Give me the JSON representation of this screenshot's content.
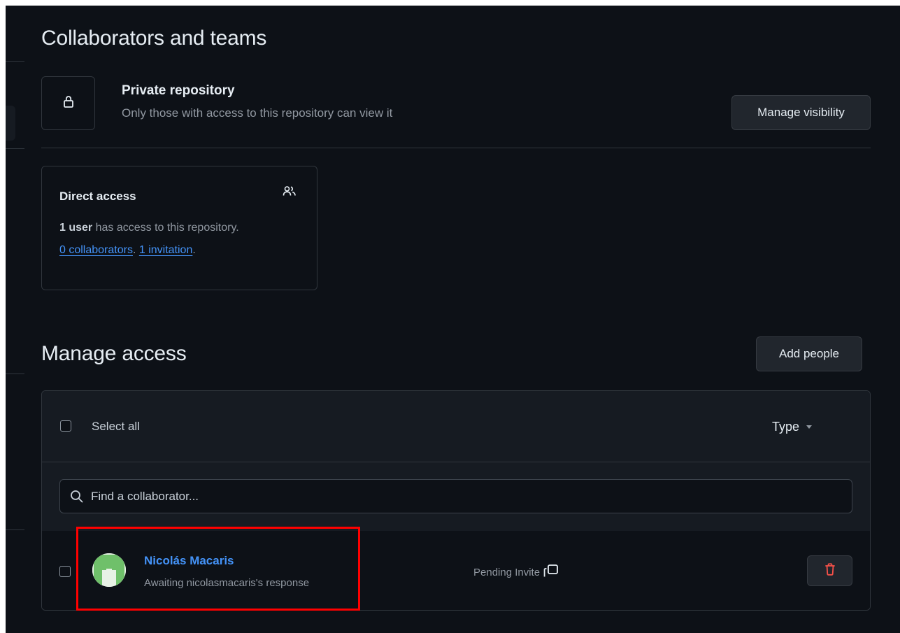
{
  "collaborators": {
    "title": "Collaborators and teams",
    "visibility": {
      "icon": "lock-icon",
      "title": "Private repository",
      "description": "Only those with access to this repository can view it",
      "button_label": "Manage visibility"
    },
    "direct_access": {
      "title": "Direct access",
      "icon": "people-icon",
      "user_count": "1 user",
      "access_text": " has access to this repository.",
      "collaborators_link": "0 collaborators",
      "separator": ". ",
      "invitations_link": "1 invitation",
      "end": "."
    }
  },
  "manage_access": {
    "title": "Manage access",
    "add_button_label": "Add people",
    "table": {
      "select_all_label": "Select all",
      "type_filter_label": "Type",
      "search_placeholder": "Find a collaborator...",
      "rows": [
        {
          "name": "Nicolás Macaris",
          "status": "Awaiting nicolasmacaris's response",
          "role": "Pending Invite",
          "avatar_icon": "identicon-avatar",
          "delete_icon": "trash-icon"
        }
      ]
    }
  },
  "colors": {
    "background": "#0d1117",
    "link": "#4493f8",
    "danger": "#f85149",
    "highlight": "#ff0000"
  }
}
